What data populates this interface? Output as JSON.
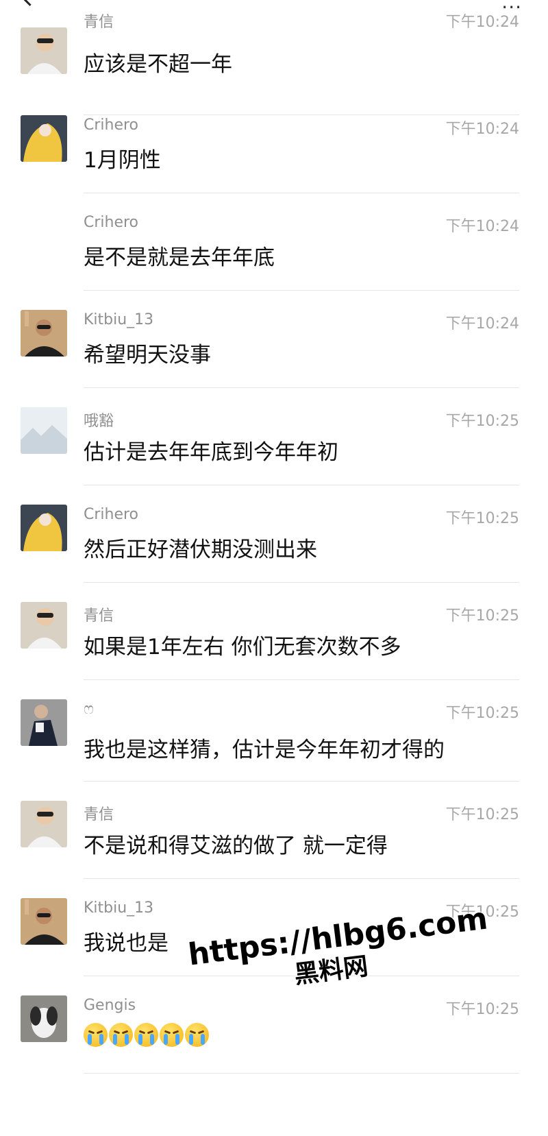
{
  "header": {
    "back_icon": "chevron-left-icon",
    "more_icon": "ellipsis-icon"
  },
  "messages": [
    {
      "sender": "青信",
      "time": "下午10:24",
      "text": "应该是不超一年",
      "avatar": "person-sunglasses"
    },
    {
      "sender": "Crihero",
      "time": "下午10:24",
      "text": "1月阴性",
      "avatar": "anime-yellow"
    },
    {
      "sender": "Crihero",
      "time": "下午10:24",
      "text": "是不是就是去年年底",
      "avatar": ""
    },
    {
      "sender": "Kitbiu_13",
      "time": "下午10:24",
      "text": "希望明天没事",
      "avatar": "person-waving"
    },
    {
      "sender": "哦豁",
      "time": "下午10:25",
      "text": "估计是去年年底到今年年初",
      "avatar": "landscape"
    },
    {
      "sender": "Crihero",
      "time": "下午10:25",
      "text": "然后正好潜伏期没测出来",
      "avatar": "anime-yellow"
    },
    {
      "sender": "青信",
      "time": "下午10:25",
      "text": "如果是1年左右 你们无套次数不多",
      "avatar": "person-sunglasses"
    },
    {
      "sender": "ෆ",
      "time": "下午10:25",
      "text": "我也是这样猜，估计是今年年初才得的",
      "avatar": "person-dark"
    },
    {
      "sender": "青信",
      "time": "下午10:25",
      "text": "不是说和得艾滋的做了 就一定得",
      "avatar": "person-sunglasses"
    },
    {
      "sender": "Kitbiu_13",
      "time": "下午10:25",
      "text": "我说也是",
      "avatar": "person-waving"
    },
    {
      "sender": "Gengis",
      "time": "下午10:25",
      "text": "",
      "emoji_count": 5,
      "emoji_icon": "crying-face-icon",
      "avatar": "dog"
    }
  ],
  "watermark": {
    "url": "https://hlbg6.com",
    "name": "黑料网"
  }
}
